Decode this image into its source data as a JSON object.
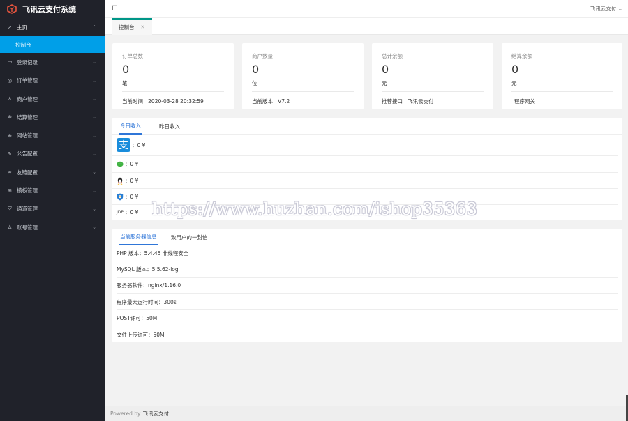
{
  "app": {
    "title": "飞讯云支付系统"
  },
  "sidebar": {
    "items": [
      {
        "icon": "send-icon",
        "label": "主页",
        "open": true
      },
      {
        "icon": "id-card-icon",
        "label": "登录记录"
      },
      {
        "icon": "coin-icon",
        "label": "订单管理"
      },
      {
        "icon": "user-icon",
        "label": "商户管理"
      },
      {
        "icon": "settlement-icon",
        "label": "结算管理"
      },
      {
        "icon": "globe-icon",
        "label": "网站管理"
      },
      {
        "icon": "pen-icon",
        "label": "公告配置"
      },
      {
        "icon": "link-icon",
        "label": "友链配置"
      },
      {
        "icon": "gamepad-icon",
        "label": "模板管理"
      },
      {
        "icon": "shield-icon",
        "label": "通道管理"
      },
      {
        "icon": "user-icon",
        "label": "账号管理"
      }
    ],
    "subitem": "控制台"
  },
  "header": {
    "user_menu": "飞讯云支付"
  },
  "tabs": {
    "active": "控制台"
  },
  "stats": [
    {
      "title": "订单总数",
      "value": "0",
      "unit": "笔",
      "foot_label": "当前时间",
      "foot_value": "2020-03-28 20:32:59"
    },
    {
      "title": "商户数量",
      "value": "0",
      "unit": "位",
      "foot_label": "当前版本",
      "foot_value": "V7.2"
    },
    {
      "title": "总计余额",
      "value": "0",
      "unit": "元",
      "foot_label": "推荐接口",
      "foot_value": "飞讯云支付"
    },
    {
      "title": "结算余额",
      "value": "0",
      "unit": "元",
      "foot_label": "程序网关",
      "foot_value": ""
    }
  ],
  "income": {
    "tabs": [
      "今日收入",
      "昨日收入"
    ],
    "rows": [
      {
        "icon": "alipay-icon",
        "text": "：0 ¥"
      },
      {
        "icon": "wechat-icon",
        "text": "：0 ¥"
      },
      {
        "icon": "qq-icon",
        "text": "：0 ¥"
      },
      {
        "icon": "tenpay-icon",
        "text": "：0 ¥"
      },
      {
        "icon": "jd-icon",
        "text": "：0 ¥"
      }
    ]
  },
  "server": {
    "tabs": [
      "当前服务器信息",
      "致用户的一封信"
    ],
    "rows": [
      "PHP 版本：5.4.45 非线程安全",
      "MySQL 版本：5.5.62-log",
      "服务器软件：nginx/1.16.0",
      "程序最大运行时间：300s",
      "POST许可：50M",
      "文件上传许可：50M"
    ]
  },
  "watermark": "https://www.huzhan.com/ishop35363",
  "footer": {
    "prefix": "Powered by",
    "brand": "飞讯云支付"
  },
  "colors": {
    "sidebar_bg": "#20222a",
    "accent": "#009fe8",
    "tab_active": "#2f76d8"
  }
}
